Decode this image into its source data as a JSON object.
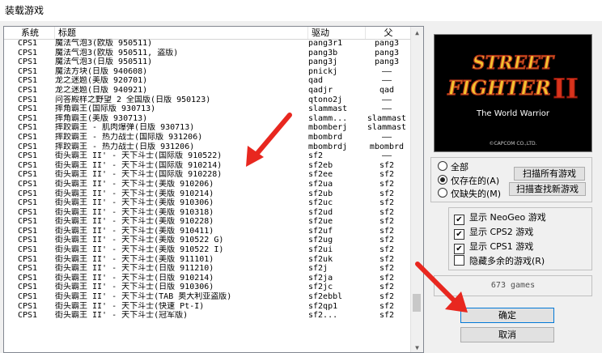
{
  "window": {
    "title": "装载游戏"
  },
  "list": {
    "columns": [
      "系统",
      "标题",
      "驱动",
      "父"
    ],
    "rows": [
      {
        "sys": "CPS1",
        "title": "魔法气泡3(欧版 950511)",
        "driver": "pang3r1",
        "parent": "pang3"
      },
      {
        "sys": "CPS1",
        "title": "魔法气泡3(欧版 950511, 盗版)",
        "driver": "pang3b",
        "parent": "pang3"
      },
      {
        "sys": "CPS1",
        "title": "魔法气泡3(日版 950511)",
        "driver": "pang3j",
        "parent": "pang3"
      },
      {
        "sys": "CPS1",
        "title": "魔法方块(日版 940608)",
        "driver": "pnickj",
        "parent": "——"
      },
      {
        "sys": "CPS1",
        "title": "龙之迷题(美版 920701)",
        "driver": "qad",
        "parent": "——"
      },
      {
        "sys": "CPS1",
        "title": "龙之迷题(日版 940921)",
        "driver": "qadjr",
        "parent": "qad"
      },
      {
        "sys": "CPS1",
        "title": "问答殿样之野望 2 全国版(日版 950123)",
        "driver": "qtono2j",
        "parent": "——"
      },
      {
        "sys": "CPS1",
        "title": "摔角霸王(国际版 930713)",
        "driver": "slammast",
        "parent": "——"
      },
      {
        "sys": "CPS1",
        "title": "摔角霸王(美版 930713)",
        "driver": "slamm...",
        "parent": "slammast"
      },
      {
        "sys": "CPS1",
        "title": "摔跤霸王 - 肌肉爆弹(日版 930713)",
        "driver": "mbomberj",
        "parent": "slammast"
      },
      {
        "sys": "CPS1",
        "title": "摔跤霸王 - 热力战士(国际版 931206)",
        "driver": "mbombrd",
        "parent": "——"
      },
      {
        "sys": "CPS1",
        "title": "摔跤霸王 - 热力战士(日版 931206)",
        "driver": "mbombrdj",
        "parent": "mbombrd"
      },
      {
        "sys": "CPS1",
        "title": "街头霸王 II' - 天下斗士(国际版 910522)",
        "driver": "sf2",
        "parent": "——"
      },
      {
        "sys": "CPS1",
        "title": "街头霸王 II' - 天下斗士(国际版 910214)",
        "driver": "sf2eb",
        "parent": "sf2"
      },
      {
        "sys": "CPS1",
        "title": "街头霸王 II' - 天下斗士(国际版 910228)",
        "driver": "sf2ee",
        "parent": "sf2"
      },
      {
        "sys": "CPS1",
        "title": "街头霸王 II' - 天下斗士(美版 910206)",
        "driver": "sf2ua",
        "parent": "sf2"
      },
      {
        "sys": "CPS1",
        "title": "街头霸王 II' - 天下斗士(美版 910214)",
        "driver": "sf2ub",
        "parent": "sf2"
      },
      {
        "sys": "CPS1",
        "title": "街头霸王 II' - 天下斗士(美版 910306)",
        "driver": "sf2uc",
        "parent": "sf2"
      },
      {
        "sys": "CPS1",
        "title": "街头霸王 II' - 天下斗士(美版 910318)",
        "driver": "sf2ud",
        "parent": "sf2"
      },
      {
        "sys": "CPS1",
        "title": "街头霸王 II' - 天下斗士(美版 910228)",
        "driver": "sf2ue",
        "parent": "sf2"
      },
      {
        "sys": "CPS1",
        "title": "街头霸王 II' - 天下斗士(美版 910411)",
        "driver": "sf2uf",
        "parent": "sf2"
      },
      {
        "sys": "CPS1",
        "title": "街头霸王 II' - 天下斗士(美版 910522 G)",
        "driver": "sf2ug",
        "parent": "sf2"
      },
      {
        "sys": "CPS1",
        "title": "街头霸王 II' - 天下斗士(美版 910522 I)",
        "driver": "sf2ui",
        "parent": "sf2"
      },
      {
        "sys": "CPS1",
        "title": "街头霸王 II' - 天下斗士(美版 911101)",
        "driver": "sf2uk",
        "parent": "sf2"
      },
      {
        "sys": "CPS1",
        "title": "街头霸王 II' - 天下斗士(日版 911210)",
        "driver": "sf2j",
        "parent": "sf2"
      },
      {
        "sys": "CPS1",
        "title": "街头霸王 II' - 天下斗士(日版 910214)",
        "driver": "sf2ja",
        "parent": "sf2"
      },
      {
        "sys": "CPS1",
        "title": "街头霸王 II' - 天下斗士(日版 910306)",
        "driver": "sf2jc",
        "parent": "sf2"
      },
      {
        "sys": "CPS1",
        "title": "街头霸王 II' - 天下斗士(TAB 奥大利亚盗版)",
        "driver": "sf2ebbl",
        "parent": "sf2"
      },
      {
        "sys": "CPS1",
        "title": "街头霸王 II' - 天下斗士(快速 Pt-I)",
        "driver": "sf2qp1",
        "parent": "sf2"
      },
      {
        "sys": "CPS1",
        "title": "街头霸王 II' - 天下斗士(冠军版)",
        "driver": "sf2...",
        "parent": "sf2"
      }
    ]
  },
  "preview": {
    "title_line1": "STREET",
    "title_line2": "FIGHTER",
    "numeral": "II",
    "subtitle": "The World Warrior",
    "copyright": "©CAPCOM CO.,LTD."
  },
  "filter": {
    "all_label": "全部",
    "available_label": "仅存在的(A)",
    "missing_label": "仅缺失的(M)",
    "scan_all_label": "扫描所有游戏",
    "scan_new_label": "扫描查找新游戏"
  },
  "display": {
    "neogeo_label": "显示 NeoGeo 游戏",
    "cps2_label": "显示 CPS2 游戏",
    "cps1_label": "显示 CPS1 游戏",
    "hide_extra_label": "隐藏多余的游戏(R)"
  },
  "count_text": "673 games",
  "buttons": {
    "ok": "确定",
    "cancel": "取消"
  },
  "colors": {
    "arrow": "#e8271f",
    "preview_bg": "#000000"
  }
}
